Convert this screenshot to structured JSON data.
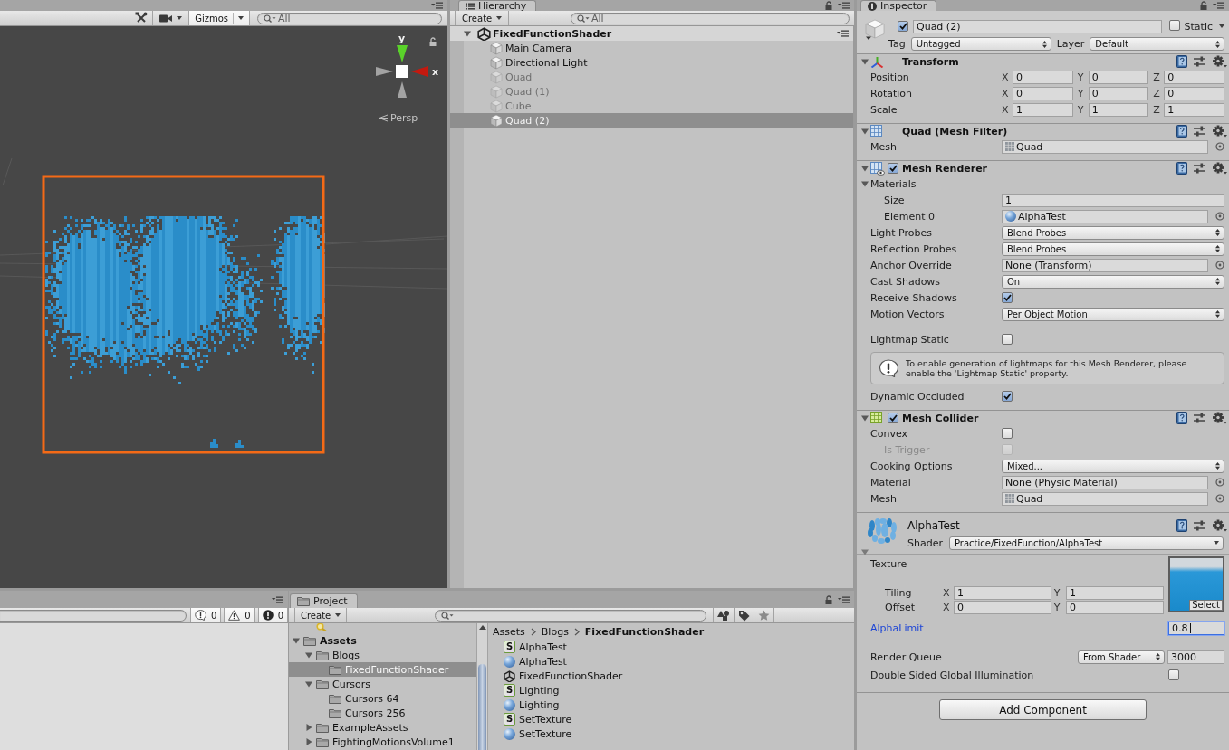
{
  "scene_view": {
    "toolbar": {
      "gizmos": "Gizmos",
      "search": {
        "placeholder": "All"
      }
    },
    "gizmo": {
      "y_label": "y",
      "x_label": "x",
      "projection": "Persp"
    }
  },
  "hierarchy": {
    "tab": "Hierarchy",
    "create": "Create",
    "search": {
      "placeholder": "All"
    },
    "scene": {
      "name": "FixedFunctionShader",
      "expanded": true
    },
    "items": [
      {
        "name": "Main Camera",
        "disabled": false,
        "selected": false
      },
      {
        "name": "Directional Light",
        "disabled": false,
        "selected": false
      },
      {
        "name": "Quad",
        "disabled": true,
        "selected": false
      },
      {
        "name": "Quad (1)",
        "disabled": true,
        "selected": false
      },
      {
        "name": "Cube",
        "disabled": true,
        "selected": false
      },
      {
        "name": "Quad (2)",
        "disabled": false,
        "selected": true
      }
    ]
  },
  "inspector": {
    "tab": "Inspector",
    "object": {
      "checked": true,
      "name": "Quad (2)",
      "static": {
        "label": "Static",
        "checked": false
      },
      "tag": {
        "label": "Tag",
        "value": "Untagged"
      },
      "layer": {
        "label": "Layer",
        "value": "Default"
      }
    },
    "components": [
      {
        "kind": "transform",
        "title": "Transform",
        "expanded": true,
        "rows": [
          {
            "kind": "vector",
            "label": "Position",
            "values": [
              {
                "axis": "X",
                "value": "0"
              },
              {
                "axis": "Y",
                "value": "0"
              },
              {
                "axis": "Z",
                "value": "0"
              }
            ]
          },
          {
            "kind": "vector",
            "label": "Rotation",
            "values": [
              {
                "axis": "X",
                "value": "0"
              },
              {
                "axis": "Y",
                "value": "0"
              },
              {
                "axis": "Z",
                "value": "0"
              }
            ]
          },
          {
            "kind": "vector",
            "label": "Scale",
            "values": [
              {
                "axis": "X",
                "value": "1"
              },
              {
                "axis": "Y",
                "value": "1"
              },
              {
                "axis": "Z",
                "value": "1"
              }
            ]
          }
        ]
      },
      {
        "kind": "mesh_filter",
        "title": "Quad (Mesh Filter)",
        "expanded": true,
        "rows": [
          {
            "kind": "mesh_object",
            "label": "Mesh",
            "value": "Quad"
          }
        ]
      },
      {
        "kind": "mesh_renderer",
        "title": "Mesh Renderer",
        "expanded": true,
        "enabled": true,
        "rows": [
          {
            "kind": "foldout",
            "label": "Materials",
            "expanded": true,
            "children": [
              {
                "kind": "text",
                "label": "Size",
                "value": "1"
              },
              {
                "kind": "material_object",
                "label": "Element 0",
                "value": "AlphaTest"
              }
            ]
          },
          {
            "kind": "dropdown",
            "label": "Light Probes",
            "value": "Blend Probes"
          },
          {
            "kind": "dropdown",
            "label": "Reflection Probes",
            "value": "Blend Probes"
          },
          {
            "kind": "object",
            "label": "Anchor Override",
            "value": "None (Transform)"
          },
          {
            "kind": "dropdown",
            "label": "Cast Shadows",
            "value": "On"
          },
          {
            "kind": "checkbox",
            "label": "Receive Shadows",
            "checked": true,
            "disabled": false
          },
          {
            "kind": "dropdown",
            "label": "Motion Vectors",
            "value": "Per Object Motion"
          }
        ],
        "lightmap_rows": [
          {
            "kind": "checkbox",
            "label": "Lightmap Static",
            "checked": false,
            "disabled": false
          },
          {
            "kind": "help",
            "text": "To enable generation of lightmaps for this Mesh Renderer, please enable the 'Lightmap Static' property."
          },
          {
            "kind": "checkbox",
            "label": "Dynamic Occluded",
            "checked": true,
            "disabled": false
          }
        ]
      },
      {
        "kind": "mesh_collider",
        "title": "Mesh Collider",
        "expanded": true,
        "enabled": true,
        "rows": [
          {
            "kind": "checkbox",
            "label": "Convex",
            "checked": false,
            "disabled": false,
            "children": [
              {
                "kind": "checkbox",
                "label": "Is Trigger",
                "checked": false,
                "disabled": true
              }
            ]
          },
          {
            "kind": "dropdown",
            "label": "Cooking Options",
            "value": "Mixed..."
          },
          {
            "kind": "object",
            "label": "Material",
            "value": "None (Physic Material)"
          },
          {
            "kind": "mesh_object",
            "label": "Mesh",
            "value": "Quad"
          }
        ]
      },
      {
        "kind": "material",
        "title": "AlphaTest",
        "expanded": true,
        "shader": {
          "label": "Shader",
          "value": "Practice/FixedFunction/AlphaTest"
        },
        "properties": [
          {
            "kind": "texture",
            "label": "Texture",
            "select": "Select",
            "tiling": {
              "label": "Tiling",
              "values": [
                {
                  "axis": "X",
                  "value": "1"
                },
                {
                  "axis": "Y",
                  "value": "1"
                }
              ]
            },
            "offset": {
              "label": "Offset",
              "values": [
                {
                  "axis": "X",
                  "value": "0"
                },
                {
                  "axis": "Y",
                  "value": "0"
                }
              ]
            }
          },
          {
            "kind": "float",
            "label": "AlphaLimit",
            "value": "0.8",
            "focused": true
          },
          {
            "kind": "render_queue",
            "label": "Render Queue",
            "mode": "From Shader",
            "value": "3000"
          },
          {
            "kind": "checkbox",
            "label": "Double Sided Global Illumination",
            "checked": false
          }
        ]
      }
    ],
    "add_component": "Add Component"
  },
  "console": {
    "counts": [
      {
        "kind": "info",
        "value": "0"
      },
      {
        "kind": "warning",
        "value": "0"
      },
      {
        "kind": "error",
        "value": "0"
      }
    ]
  },
  "project": {
    "tab": "Project",
    "create": "Create",
    "tree": [
      {
        "name": "Assets",
        "expanded": true,
        "selected": false,
        "children": [
          {
            "name": "Blogs",
            "expanded": true,
            "selected": false,
            "children": [
              {
                "name": "FixedFunctionShader",
                "selected": true
              }
            ]
          },
          {
            "name": "Cursors",
            "expanded": true,
            "selected": false,
            "children": [
              {
                "name": "Cursors 64",
                "selected": false
              },
              {
                "name": "Cursors 256",
                "selected": false
              }
            ]
          },
          {
            "name": "ExampleAssets",
            "expanded": false,
            "selected": false
          },
          {
            "name": "FightingMotionsVolume1",
            "expanded": false,
            "selected": false
          }
        ]
      }
    ],
    "breadcrumb": [
      "Assets",
      "Blogs",
      "FixedFunctionShader"
    ],
    "assets": [
      {
        "name": "AlphaTest",
        "kind": "shader",
        "icon_label": "S"
      },
      {
        "name": "AlphaTest",
        "kind": "material"
      },
      {
        "name": "FixedFunctionShader",
        "kind": "scene"
      },
      {
        "name": "Lighting",
        "kind": "shader",
        "icon_label": "S"
      },
      {
        "name": "Lighting",
        "kind": "material"
      },
      {
        "name": "SetTexture",
        "kind": "shader",
        "icon_label": "S"
      },
      {
        "name": "SetTexture",
        "kind": "material"
      }
    ]
  }
}
